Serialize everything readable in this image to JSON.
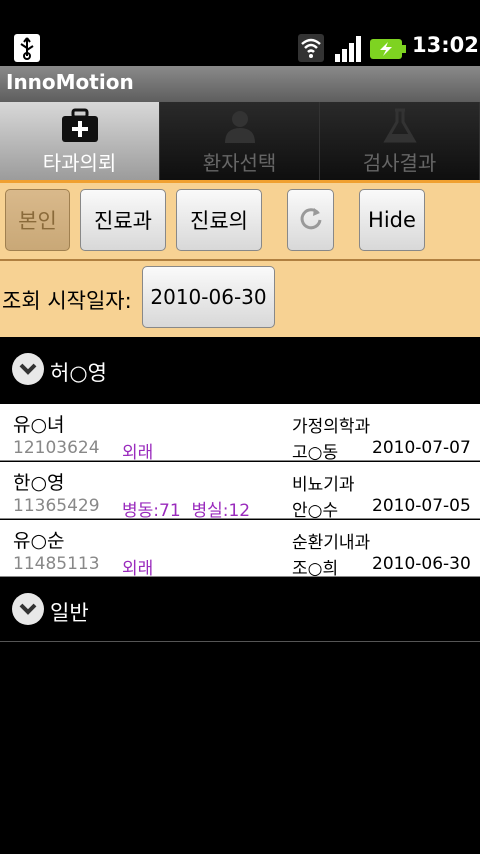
{
  "status_bar": {
    "time": "13:02",
    "icons": [
      "usb-icon",
      "wifi-icon",
      "signal-icon",
      "battery-charging-icon"
    ]
  },
  "app": {
    "title": "InnoMotion"
  },
  "tabs": [
    {
      "label": "타과의뢰",
      "icon": "medical-kit-icon",
      "active": true
    },
    {
      "label": "환자선택",
      "icon": "person-icon",
      "active": false
    },
    {
      "label": "검사결과",
      "icon": "flask-icon",
      "active": false
    }
  ],
  "toolbar": {
    "self_label": "본인",
    "dept_label": "진료과",
    "doctor_label": "진료의",
    "refresh_icon": "refresh-icon",
    "hide_label": "Hide"
  },
  "date_filter": {
    "label": "조회 시작일자:",
    "value": "2010-06-30"
  },
  "groups": [
    {
      "title": "허○영",
      "rows": [
        {
          "name": "유○녀",
          "id": "12103624",
          "ward": "외래",
          "dept": "가정의학과",
          "doctor": "고○동",
          "date": "2010-07-07"
        },
        {
          "name": "한○영",
          "id": "11365429",
          "ward": "병동:71  병실:12",
          "dept": "비뇨기과",
          "doctor": "안○수",
          "date": "2010-07-05"
        },
        {
          "name": "유○순",
          "id": "11485113",
          "ward": "외래",
          "dept": "순환기내과",
          "doctor": "조○희",
          "date": "2010-06-30"
        }
      ]
    },
    {
      "title": "일반",
      "rows": []
    }
  ],
  "colors": {
    "accent_bg": "#f7d293",
    "ward_text": "#9a2bbd"
  }
}
